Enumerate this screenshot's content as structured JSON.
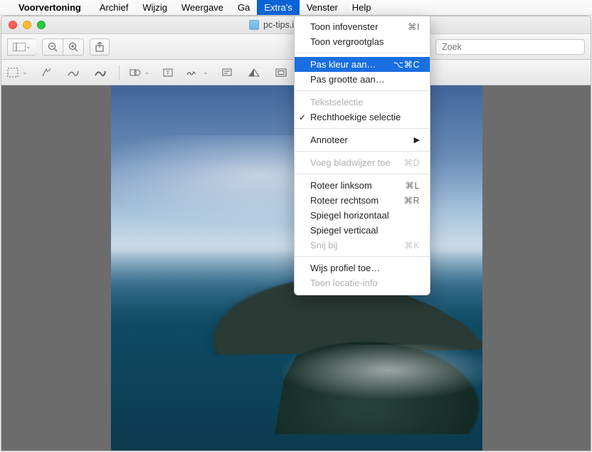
{
  "menubar": {
    "app_name": "Voorvertoning",
    "items": [
      "Archief",
      "Wijzig",
      "Weergave",
      "Ga",
      "Extra's",
      "Venster",
      "Help"
    ],
    "open_index": 4
  },
  "window": {
    "title": "pc-tips.info voorbeel"
  },
  "toolbar": {
    "search_placeholder": "Zoek",
    "icons": {
      "view_mode": "view-mode-icon",
      "zoom_out": "zoom-out-icon",
      "zoom_in": "zoom-in-icon",
      "share": "share-icon",
      "search": "search-icon"
    }
  },
  "tools2": {
    "icons": [
      "selection-icon",
      "magic-wand-icon",
      "lasso-icon",
      "lasso-plus-icon",
      "shapes-icon",
      "text-icon",
      "signature-icon",
      "annotate-icon",
      "color-adjust-icon",
      "crop-icon"
    ]
  },
  "menu": {
    "items": [
      {
        "label": "Toon infovenster",
        "shortcut": "⌘I",
        "type": "normal"
      },
      {
        "label": "Toon vergrootglas",
        "shortcut": "",
        "type": "normal"
      },
      {
        "type": "sep"
      },
      {
        "label": "Pas kleur aan…",
        "shortcut": "⌥⌘C",
        "type": "highlight"
      },
      {
        "label": "Pas grootte aan…",
        "shortcut": "",
        "type": "normal"
      },
      {
        "type": "sep"
      },
      {
        "label": "Tekstselectie",
        "shortcut": "",
        "type": "disabled"
      },
      {
        "label": "Rechthoekige selectie",
        "shortcut": "",
        "type": "checked"
      },
      {
        "type": "sep"
      },
      {
        "label": "Annoteer",
        "shortcut": "",
        "type": "submenu"
      },
      {
        "type": "sep"
      },
      {
        "label": "Voeg bladwijzer toe",
        "shortcut": "⌘D",
        "type": "disabled"
      },
      {
        "type": "sep"
      },
      {
        "label": "Roteer linksom",
        "shortcut": "⌘L",
        "type": "normal"
      },
      {
        "label": "Roteer rechtsom",
        "shortcut": "⌘R",
        "type": "normal"
      },
      {
        "label": "Spiegel horizontaal",
        "shortcut": "",
        "type": "normal"
      },
      {
        "label": "Spiegel verticaal",
        "shortcut": "",
        "type": "normal"
      },
      {
        "label": "Snij bij",
        "shortcut": "⌘K",
        "type": "disabled"
      },
      {
        "type": "sep"
      },
      {
        "label": "Wijs profiel toe…",
        "shortcut": "",
        "type": "normal"
      },
      {
        "label": "Toon locatie-info",
        "shortcut": "",
        "type": "disabled"
      }
    ]
  }
}
